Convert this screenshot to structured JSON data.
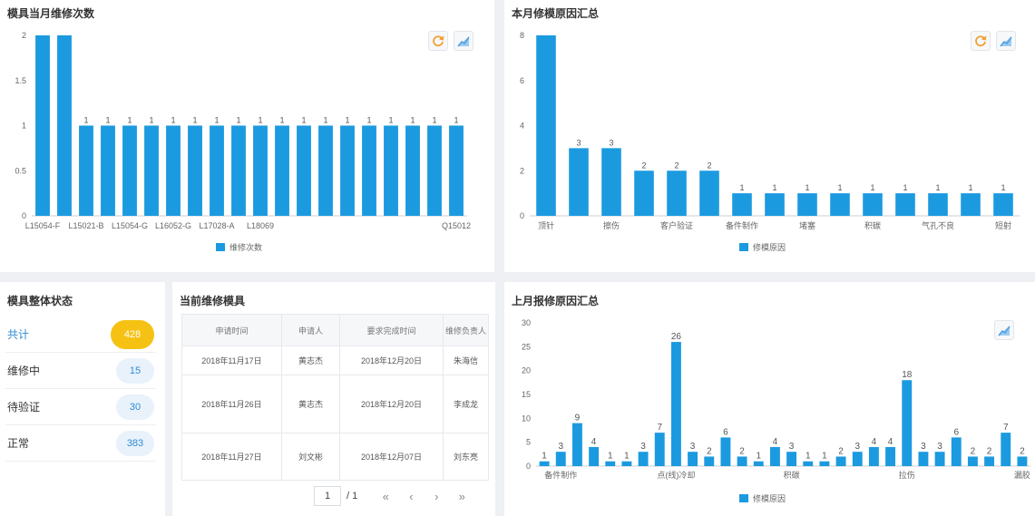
{
  "colors": {
    "bar": "#1b9ae0",
    "accent": "#2e8bd6",
    "highlight": "#f5c214",
    "refresh_icon": "#f0a030",
    "chart_icon": "#4a9ee0"
  },
  "monthly_repairs": {
    "title": "模具当月维修次数",
    "toolbar": {
      "refresh_icon": "refresh-icon",
      "chart_type_icon": "line-chart-icon"
    },
    "chart_data": {
      "type": "bar",
      "categories": [
        "L15054-F",
        "",
        "L15021-B",
        "",
        "L15054-G",
        "",
        "L16052-G",
        "",
        "L17028-A",
        "",
        "L18069",
        "",
        "",
        "",
        "",
        "",
        "",
        "",
        "",
        "Q15012"
      ],
      "values": [
        2,
        2,
        1,
        1,
        1,
        1,
        1,
        1,
        1,
        1,
        1,
        1,
        1,
        1,
        1,
        1,
        1,
        1,
        1,
        1
      ],
      "data_labels": [
        "",
        "",
        "1",
        "1",
        "1",
        "1",
        "1",
        "1",
        "1",
        "1",
        "1",
        "1",
        "1",
        "1",
        "1",
        "1",
        "1",
        "1",
        "1",
        "1"
      ],
      "yticks": [
        "0",
        "0.5",
        "1",
        "1.5",
        "2"
      ],
      "ylim": [
        0,
        2
      ],
      "legend": "维修次数",
      "legend_position": "bottom"
    }
  },
  "current_reasons": {
    "title": "本月修模原因汇总",
    "toolbar": {
      "refresh_icon": "refresh-icon",
      "chart_type_icon": "line-chart-icon"
    },
    "chart_data": {
      "type": "bar",
      "categories": [
        "顶针",
        "",
        "擦伤",
        "",
        "客户验证",
        "",
        "备件制作",
        "",
        "堵塞",
        "",
        "积碳",
        "",
        "气孔不良",
        "",
        "短射"
      ],
      "values": [
        8,
        3,
        3,
        2,
        2,
        2,
        1,
        1,
        1,
        1,
        1,
        1,
        1,
        1,
        1
      ],
      "data_labels": [
        "",
        "3",
        "3",
        "2",
        "2",
        "2",
        "1",
        "1",
        "1",
        "1",
        "1",
        "1",
        "1",
        "1",
        "1"
      ],
      "yticks": [
        "0",
        "2",
        "4",
        "6",
        "8"
      ],
      "ylim": [
        0,
        8
      ],
      "legend": "修模原因",
      "legend_position": "bottom"
    }
  },
  "status": {
    "title": "模具整体状态",
    "rows": [
      {
        "label": "共计",
        "value": "428"
      },
      {
        "label": "维修中",
        "value": "15"
      },
      {
        "label": "待验证",
        "value": "30"
      },
      {
        "label": "正常",
        "value": "383"
      }
    ]
  },
  "current_molds": {
    "title": "当前维修模具",
    "headers": [
      "申请时间",
      "申请人",
      "要求完成时间",
      "维修负责人"
    ],
    "rows": [
      [
        "2018年11月17日",
        "黄志杰",
        "2018年12月20日",
        "朱海信"
      ],
      [
        "2018年11月26日",
        "黄志杰",
        "2018年12月20日",
        "李成龙"
      ],
      [
        "2018年11月27日",
        "刘文彬",
        "2018年12月07日",
        "刘东亮"
      ]
    ],
    "pager": {
      "page": "1",
      "total": "/ 1",
      "first": "«",
      "prev": "‹",
      "next": "›",
      "last": "»"
    }
  },
  "last_reasons": {
    "title": "上月报修原因汇总",
    "toolbar": {
      "chart_type_icon": "line-chart-icon"
    },
    "chart_data": {
      "type": "bar",
      "categories": [
        "备件制作",
        "",
        "",
        "",
        "",
        "",
        "",
        "",
        "点(线)冷却",
        "",
        "",
        "",
        "",
        "",
        "",
        "积碳",
        "",
        "",
        "",
        "",
        "",
        "",
        "拉伤",
        "",
        "",
        "",
        "",
        "",
        "",
        "漏胶",
        "",
        "",
        "",
        "",
        "",
        ""
      ],
      "values": [
        1,
        3,
        9,
        4,
        1,
        1,
        3,
        7,
        26,
        3,
        2,
        6,
        2,
        1,
        4,
        3,
        1,
        1,
        2,
        3,
        4,
        4,
        18,
        3,
        3,
        6,
        2,
        2,
        7,
        2
      ],
      "data_labels": [
        "1",
        "3",
        "9",
        "4",
        "1",
        "1",
        "3",
        "7",
        "26",
        "3",
        "2",
        "6",
        "2",
        "1",
        "4",
        "3",
        "1",
        "1",
        "2",
        "3",
        "4",
        "4",
        "18",
        "3",
        "3",
        "6",
        "2",
        "2",
        "7",
        "2"
      ],
      "x_tick_labels": [
        "备件制作",
        "点(线)冷却",
        "积碳",
        "拉伤",
        "漏胶"
      ],
      "yticks": [
        "0",
        "5",
        "10",
        "15",
        "20",
        "25",
        "30"
      ],
      "ylim": [
        0,
        30
      ],
      "legend": "修模原因",
      "legend_position": "bottom"
    }
  }
}
